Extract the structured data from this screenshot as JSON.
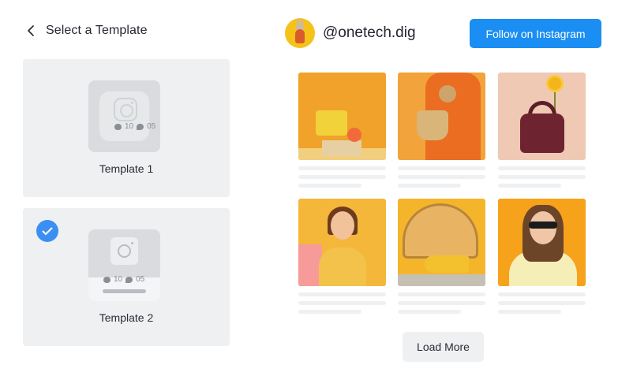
{
  "panel": {
    "title": "Select a Template",
    "back_icon": "chevron-left-icon"
  },
  "templates": [
    {
      "label": "Template 1",
      "likes": "10",
      "comments": "05",
      "selected": false
    },
    {
      "label": "Template 2",
      "likes": "10",
      "comments": "05",
      "selected": true
    }
  ],
  "profile": {
    "handle": "@onetech.dig",
    "follow_label": "Follow on Instagram"
  },
  "posts": [
    {
      "image": "yellow handbag with oranges"
    },
    {
      "image": "woman in orange dress holding straw basket"
    },
    {
      "image": "brown leather handbag with sunflower"
    },
    {
      "image": "woman in yellow hoodie smiling"
    },
    {
      "image": "yellow sandals and woven fan bag"
    },
    {
      "image": "woman with yellow sunglasses"
    }
  ],
  "load_more_label": "Load More",
  "colors": {
    "accent": "#1a8ef2",
    "check": "#3b8ff3",
    "card_bg": "#eef0f2"
  }
}
